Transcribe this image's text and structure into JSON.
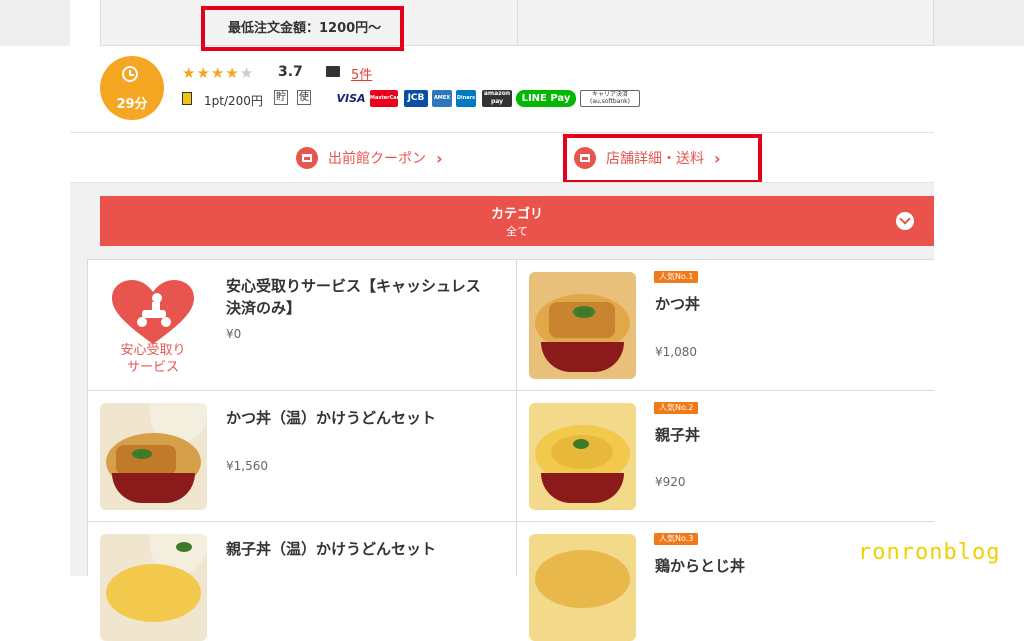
{
  "header": {
    "min_order": "最低注文金額：1200円〜"
  },
  "shop_info": {
    "delivery_time": "29分",
    "rating_value": 3.7,
    "rating_text": "3.7",
    "review_link": "5件",
    "point_rate": "1pt/200円",
    "point_badges": [
      "貯",
      "使"
    ],
    "payment_methods": [
      "VISA",
      "MasterCard",
      "JCB",
      "AMEX",
      "Diners",
      "amazon pay",
      "LINE Pay",
      "キャリア決済 (au,softbank)"
    ]
  },
  "links": {
    "coupon": "出前館クーポン",
    "shop_details": "店舗詳細・送料"
  },
  "category": {
    "title": "カテゴリ",
    "selected": "全て"
  },
  "menu_items": [
    {
      "name_line1": "安心受取りサービス【キャッシュレス",
      "name_line2": "決済のみ】",
      "price": "¥0",
      "image_label_line1": "安心受取り",
      "image_label_line2": "サービス"
    },
    {
      "rank": "人気No.1",
      "name": "かつ丼",
      "price": "¥1,080"
    },
    {
      "name": "かつ丼（温）かけうどんセット",
      "price": "¥1,560"
    },
    {
      "rank": "人気No.2",
      "name": "親子丼",
      "price": "¥920"
    },
    {
      "name": "親子丼（温）かけうどんセット"
    },
    {
      "rank": "人気No.3",
      "name": "鶏からとじ丼"
    }
  ],
  "watermark": "ronronblog",
  "colors": {
    "accent": "#e9534c",
    "time_badge": "#f5a623",
    "highlight_box": "#e3001b",
    "rank_badge": "#f07a1a"
  }
}
